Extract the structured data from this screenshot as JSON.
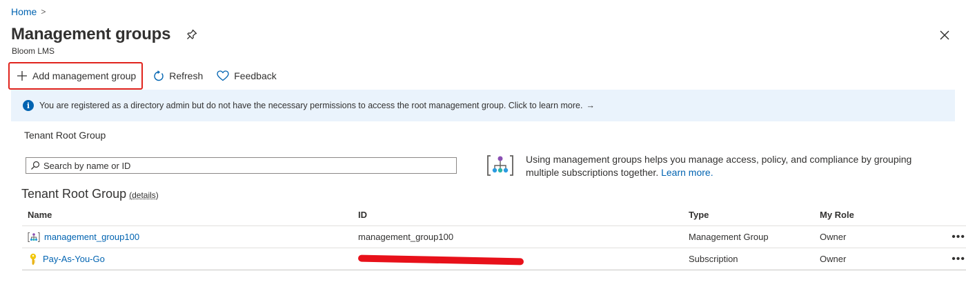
{
  "breadcrumb": {
    "home": "Home",
    "separator": ">"
  },
  "header": {
    "title": "Management groups",
    "subtitle": "Bloom LMS"
  },
  "toolbar": {
    "add_label": "Add management group",
    "refresh_label": "Refresh",
    "feedback_label": "Feedback"
  },
  "info": {
    "message": "You are registered as a directory admin but do not have the necessary permissions to access the root management group. Click to learn more.",
    "arrow": "→"
  },
  "scope": {
    "label": "Tenant Root Group"
  },
  "search": {
    "placeholder": "Search by name or ID"
  },
  "promo": {
    "text": "Using management groups helps you manage access, policy, and compliance by grouping multiple subscriptions together.",
    "link": "Learn more."
  },
  "group": {
    "heading": "Tenant Root Group",
    "details": "(details)"
  },
  "table": {
    "headers": {
      "name": "Name",
      "id": "ID",
      "type": "Type",
      "role": "My Role"
    },
    "rows": [
      {
        "name": "management_group100",
        "id": "management_group100",
        "type": "Management Group",
        "role": "Owner",
        "icon": "management-group-icon",
        "more": "•••"
      },
      {
        "name": "Pay-As-You-Go",
        "id": "",
        "type": "Subscription",
        "role": "Owner",
        "icon": "key-icon",
        "more": "•••"
      }
    ]
  },
  "colors": {
    "accent": "#0063b1",
    "highlight_border": "#e0231c",
    "info_bg": "#eaf3fc"
  }
}
